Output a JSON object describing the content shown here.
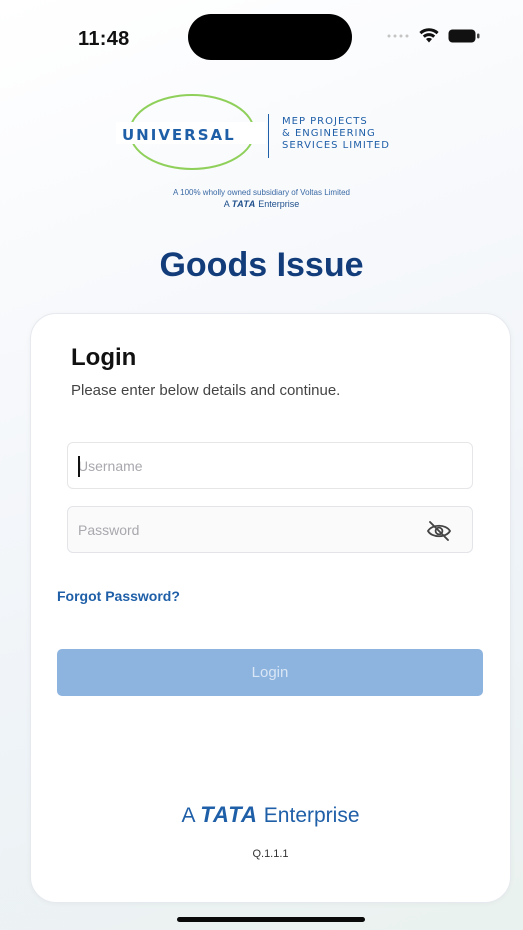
{
  "status_bar": {
    "time": "11:48"
  },
  "logo": {
    "name": "UNIVERSAL",
    "subtitle": "MEP PROJECTS\n& ENGINEERING\nSERVICES LIMITED",
    "subsidiary_text": "A 100% wholly owned subsidiary of Voltas Limited",
    "tata_prefix": "A",
    "tata_brand": "TATA",
    "tata_suffix": "Enterprise"
  },
  "app": {
    "title": "Goods Issue"
  },
  "login_card": {
    "heading": "Login",
    "subheading": "Please enter below details and continue.",
    "username": {
      "value": "",
      "placeholder": "Username"
    },
    "password": {
      "value": "",
      "placeholder": "Password"
    },
    "forgot_password": "Forgot Password?",
    "login_button": "Login",
    "footer": {
      "tata_prefix": "A",
      "tata_brand": "TATA",
      "tata_suffix": "Enterprise"
    },
    "version": "Q.1.1.1"
  },
  "colors": {
    "brand_blue": "#1f5fa8",
    "title_navy": "#123d7a",
    "button_disabled": "#8db3df",
    "logo_swoosh": "#8fd05a"
  }
}
